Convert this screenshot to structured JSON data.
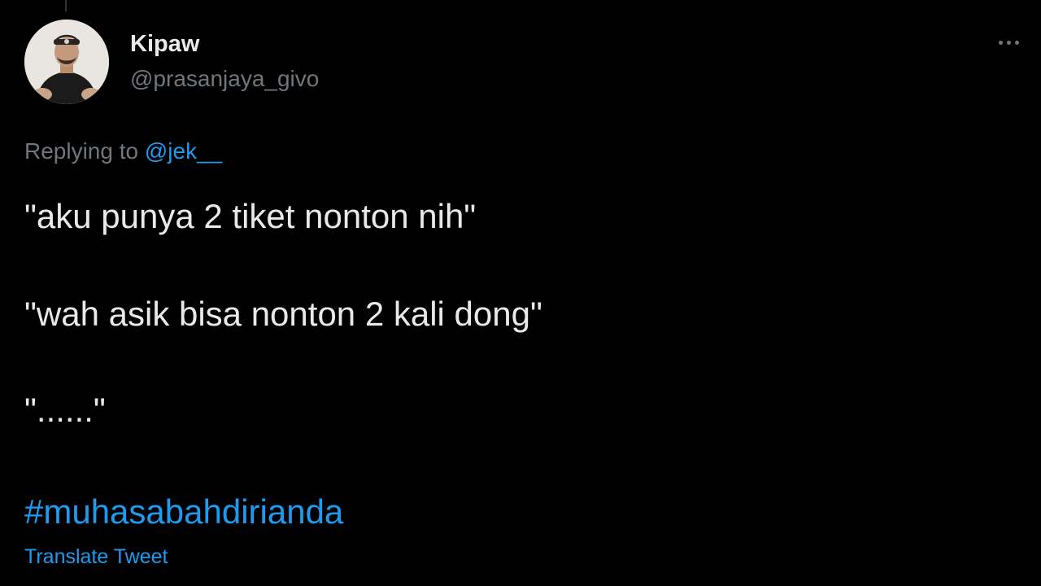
{
  "tweet": {
    "author": {
      "display_name": "Kipaw",
      "handle": "@prasanjaya_givo",
      "avatar_icon": "user-avatar-photo"
    },
    "menu_icon": "more-options-icon",
    "replying_to": {
      "prefix": "Replying to ",
      "mention": "@jek__"
    },
    "lines": [
      "\"aku punya 2 tiket nonton nih\"",
      "\"wah asik bisa nonton 2 kali dong\"",
      "\"......\""
    ],
    "hashtag": "#muhasabahdirianda",
    "translate_label": "Translate Tweet"
  },
  "colors": {
    "background": "#000000",
    "primary_text": "#e7e9ea",
    "secondary_text": "#71767b",
    "accent": "#1d9bf0"
  }
}
